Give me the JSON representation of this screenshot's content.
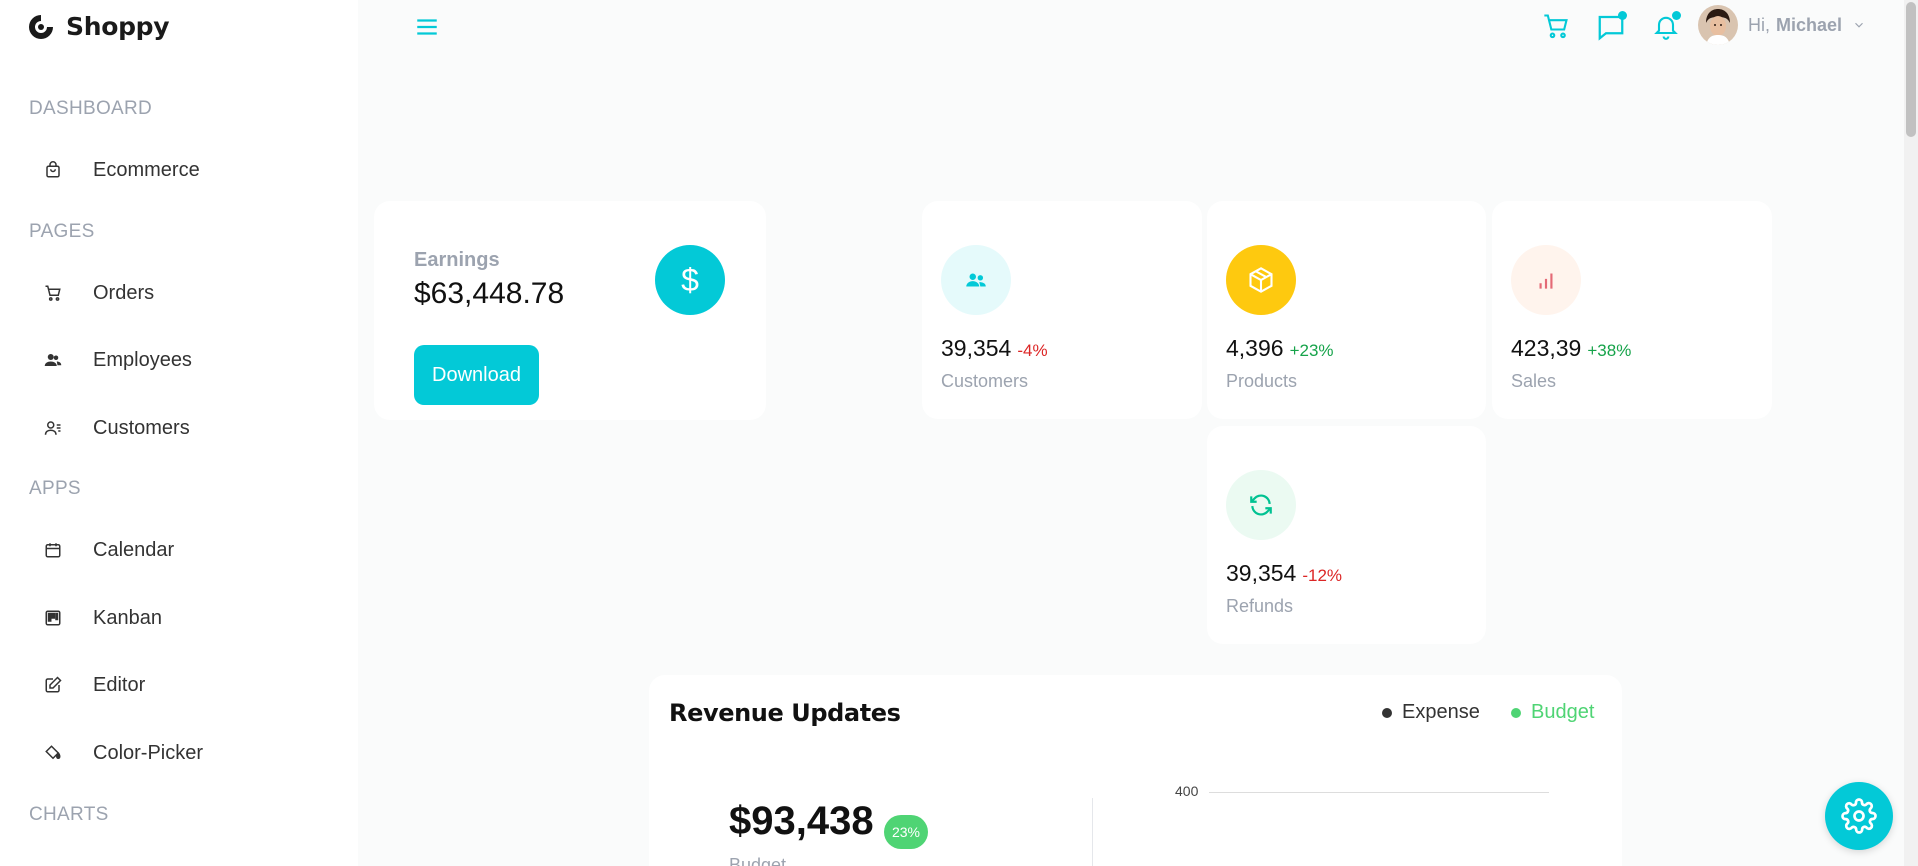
{
  "app": {
    "name": "Shoppy"
  },
  "colors": {
    "accent": "#03c9d7",
    "negative": "#dc2626",
    "positive": "#16a34a",
    "budget": "#4fd474",
    "expense": "#333333"
  },
  "sidebar": {
    "sections": [
      {
        "label": "DASHBOARD",
        "items": [
          {
            "label": "Ecommerce",
            "icon": "shopping-bag-icon"
          }
        ]
      },
      {
        "label": "PAGES",
        "items": [
          {
            "label": "Orders",
            "icon": "cart-icon"
          },
          {
            "label": "Employees",
            "icon": "employees-icon"
          },
          {
            "label": "Customers",
            "icon": "customers-icon"
          }
        ]
      },
      {
        "label": "APPS",
        "items": [
          {
            "label": "Calendar",
            "icon": "calendar-icon"
          },
          {
            "label": "Kanban",
            "icon": "kanban-icon"
          },
          {
            "label": "Editor",
            "icon": "edit-icon"
          },
          {
            "label": "Color-Picker",
            "icon": "paint-bucket-icon"
          }
        ]
      },
      {
        "label": "CHARTS",
        "items": []
      }
    ]
  },
  "topbar": {
    "greeting": "Hi,",
    "username": "Michael",
    "icons": [
      "menu-icon",
      "cart-icon",
      "chat-icon",
      "bell-icon",
      "chevron-down-icon"
    ]
  },
  "earnings": {
    "title": "Earnings",
    "value": "$63,448.78",
    "button": "Download",
    "icon": "dollar-icon",
    "icon_text": "$"
  },
  "stats": [
    {
      "value": "39,354",
      "change": "-4%",
      "trend": "down",
      "label": "Customers",
      "icon": "users-icon",
      "icon_bg": "#e5fafb",
      "icon_color": "#03c9d7"
    },
    {
      "value": "4,396",
      "change": "+23%",
      "trend": "up",
      "label": "Products",
      "icon": "box-icon",
      "icon_bg": "#fec90f",
      "icon_color": "#ffffff"
    },
    {
      "value": "423,39",
      "change": "+38%",
      "trend": "up",
      "label": "Sales",
      "icon": "bar-chart-icon",
      "icon_bg": "#fff4ed",
      "icon_color": "#e46a76"
    },
    {
      "value": "39,354",
      "change": "-12%",
      "trend": "down",
      "label": "Refunds",
      "icon": "refresh-icon",
      "icon_bg": "#ebfaf2",
      "icon_color": "#00c292"
    }
  ],
  "revenue": {
    "title": "Revenue Updates",
    "legend": [
      {
        "label": "Expense",
        "color": "#333333"
      },
      {
        "label": "Budget",
        "color": "#4fd474"
      }
    ],
    "budget_value": "$93,438",
    "budget_badge": "23%",
    "budget_label": "Budget",
    "axis_tick": "400"
  }
}
